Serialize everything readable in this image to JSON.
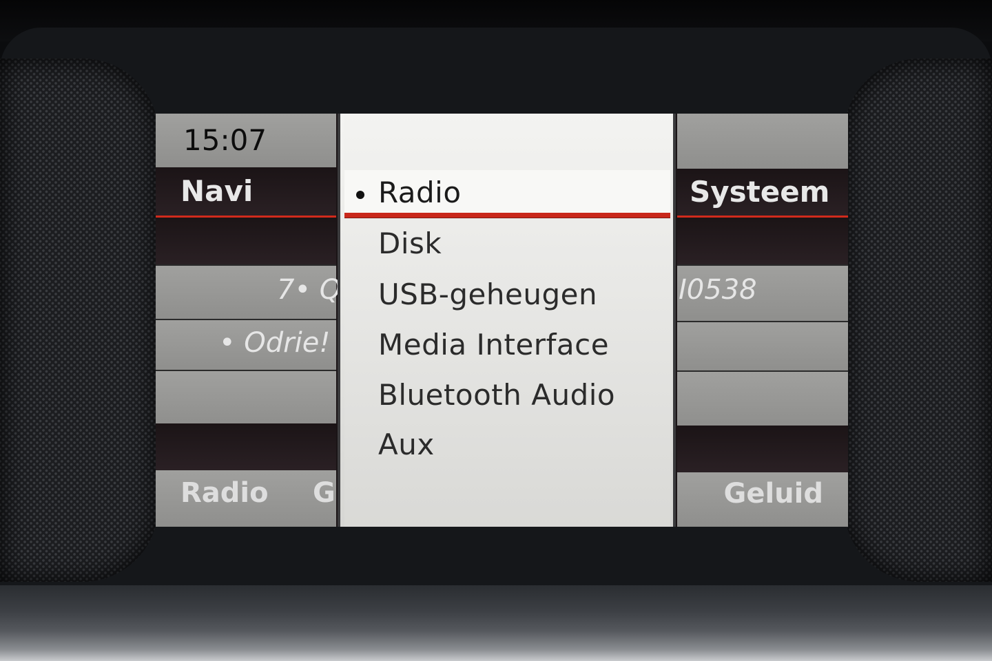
{
  "status": {
    "time": "15:07"
  },
  "header": {
    "left": "Navi",
    "right": "Systeem"
  },
  "background": {
    "left_row_1": "7• Q",
    "left_row_2": "• Odrie!",
    "right_row_1": "I0538"
  },
  "footer": {
    "left": "Radio",
    "left_partial": "G",
    "right": "Geluid"
  },
  "menu": {
    "items": [
      {
        "label": "Radio",
        "selected": true
      },
      {
        "label": "Disk",
        "selected": false
      },
      {
        "label": "USB-geheugen",
        "selected": false
      },
      {
        "label": "Media Interface",
        "selected": false
      },
      {
        "label": "Bluetooth Audio",
        "selected": false
      },
      {
        "label": "Aux",
        "selected": false
      }
    ]
  },
  "colors": {
    "accent_red": "#d12a1c",
    "panel_grey": "#9a9a98",
    "panel_dark": "#1b1416"
  }
}
